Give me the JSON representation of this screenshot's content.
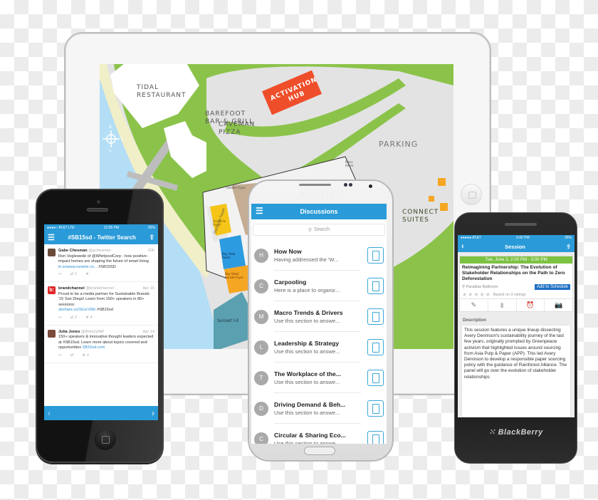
{
  "ipad_map": {
    "labels": {
      "tidal_restaurant": "TIDAL\nRESTAURANT",
      "barefoot_bar": "BAREFOOT\nBAR & GRILL",
      "caveman_pizza": "CAVEMAN\nPIZZA",
      "activation_hub": "ACTIVATION\nHUB",
      "parking": "PARKING",
      "connect_suites": "CONNECT\nSUITES",
      "garden_foyer": "Garden Foyer",
      "dockside_foyer": "Dockside Foyer",
      "dockside_room": "Dockside\nRoom",
      "bay_view_room": "Bay View\nRoom",
      "bay_view_sunset_foyer": "Bay View/\nSunset Foyer",
      "sunset": "Sunset I-II",
      "press_room": "Press\nRoom"
    },
    "compass": {
      "n": "N",
      "e": "E",
      "s": "S",
      "w": "W"
    },
    "colors": {
      "grass": "#8bc34a",
      "water": "#b3def5",
      "sand": "#f1efc8",
      "hub": "#ef4e2a",
      "paving": "#e3e3e3"
    }
  },
  "iphone": {
    "status": {
      "carrier": "●●●●○ AT&T  LTE",
      "time": "12:05 PM",
      "battery": "95%"
    },
    "title": "#SB15sd - Twitter Search",
    "tweets": [
      {
        "name": "Gabe Chesman",
        "handle": "@gchesman",
        "date": "20h",
        "text": "Ron Voglewede of @WhirlpoolCorp - how positive-impact homes are shaping the future of smart living",
        "link": "ln.is/www.csrwire.co...",
        "tag": "#SB15SD",
        "retweets": "1",
        "favorites": ""
      },
      {
        "name": "brandchannel",
        "handle": "@brandchannel",
        "date": "Apr 15",
        "text": "Proud to be a media partner for Sustainable Brands '15 San Diego! Learn from 150+ speakers in 80+ sessions:",
        "link": "sbshare.co/1EscVMc",
        "tag": "#SB15sd",
        "retweets": "2",
        "favorites": "4"
      },
      {
        "name": "Julia Jones",
        "handle": "@BreezyNM",
        "date": "Apr 14",
        "text": "150+ speakers & innovative thought leaders expected at #SB15sd. Learn more about topics covered and opportunities",
        "link": "SB15sd.com",
        "tag": "",
        "retweets": "",
        "favorites": "2"
      }
    ],
    "accent": "#2a9bd8"
  },
  "samsung": {
    "brand": "SAMSUNG",
    "title": "Discussions",
    "search_placeholder": "Search",
    "items": [
      {
        "initial": "H",
        "title": "How Now",
        "subtitle": "Having addressed the 'W..."
      },
      {
        "initial": "C",
        "title": "Carpooling",
        "subtitle": "Here is a place to organiz..."
      },
      {
        "initial": "M",
        "title": "Macro Trends & Drivers",
        "subtitle": "Use this section to answe..."
      },
      {
        "initial": "L",
        "title": "Leadership & Strategy",
        "subtitle": "Use this section to answe..."
      },
      {
        "initial": "T",
        "title": "The Workplace of the...",
        "subtitle": "Use this section to answe..."
      },
      {
        "initial": "D",
        "title": "Driving Demand & Beh...",
        "subtitle": "Use this section to answe..."
      },
      {
        "initial": "C",
        "title": "Circular & Sharing Eco...",
        "subtitle": "Use this section to answe..."
      }
    ]
  },
  "blackberry": {
    "brand": "BlackBerry",
    "status": {
      "carrier": "●●●●● AT&T",
      "time": "3:42 PM",
      "battery": "35%"
    },
    "title": "Session",
    "date": "Tue, June 3, 2:00 PM - 3:00 PM",
    "session_title": "Reimagining Partnership: The Evolution of Stakeholder Relationships on the Path to Zero Deforestation",
    "location": "Paradise Ballroom",
    "add_button": "Add to Schedule",
    "rating_text": "Based on 0 ratings",
    "rating": 0,
    "description_label": "Description",
    "description": "This session features a unique lineup dissecting Avery Dennison's sustainability journey of the last few years, originally prompted by Greenpeace activism that highlighted issues around sourcing from Asia Pulp & Paper (APP). This led Avery Dennison to develop a responsible paper sourcing policy with the guidance of Rainforest Alliance. The panel will go over the evolution of stakeholder relationships"
  }
}
